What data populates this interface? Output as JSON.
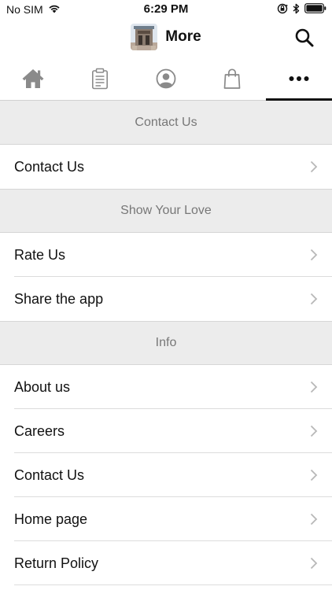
{
  "status_bar": {
    "carrier": "No SIM",
    "time": "6:29 PM"
  },
  "header": {
    "title": "More"
  },
  "tabs": [
    {
      "icon": "home-icon",
      "active": false
    },
    {
      "icon": "clipboard-icon",
      "active": false
    },
    {
      "icon": "user-icon",
      "active": false
    },
    {
      "icon": "shopping-bag-icon",
      "active": false
    },
    {
      "icon": "more-dots-icon",
      "active": true
    }
  ],
  "sections": [
    {
      "title": "Contact Us",
      "items": [
        "Contact Us"
      ]
    },
    {
      "title": "Show Your Love",
      "items": [
        "Rate Us",
        "Share the app"
      ]
    },
    {
      "title": "Info",
      "items": [
        "About us",
        "Careers",
        "Contact Us",
        "Home page",
        "Return Policy"
      ]
    }
  ],
  "colors": {
    "section_bg": "#ececec",
    "section_text": "#777777",
    "chevron": "#b8b8b8",
    "active_tab_indicator": "#111111"
  }
}
